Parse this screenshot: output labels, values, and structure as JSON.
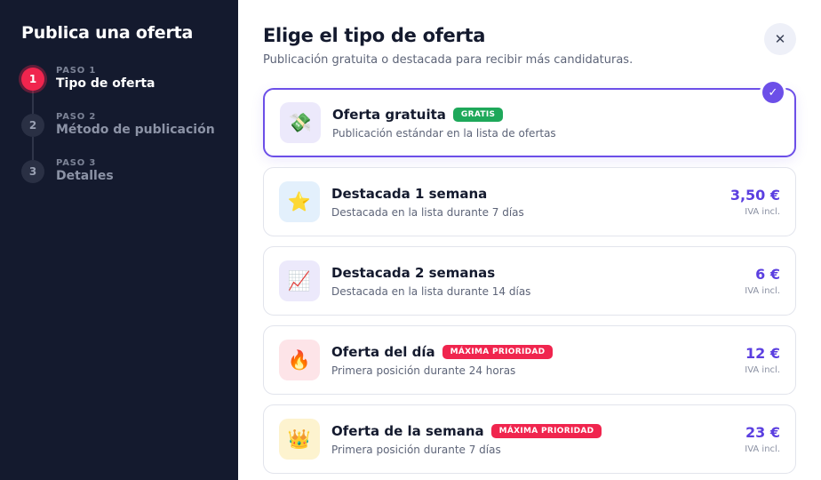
{
  "sidebar": {
    "title": "Publica una oferta",
    "steps": [
      {
        "number": "1",
        "kicker": "PASO 1",
        "label": "Tipo de oferta",
        "active": true
      },
      {
        "number": "2",
        "kicker": "PASO 2",
        "label": "Método de publicación",
        "active": false
      },
      {
        "number": "3",
        "kicker": "PASO 3",
        "label": "Detalles",
        "active": false
      }
    ]
  },
  "main": {
    "title": "Elige el tipo de oferta",
    "subtitle": "Publicación gratuita o destacada para recibir más candidaturas.",
    "close_icon": "✕",
    "check_icon": "✓"
  },
  "options": [
    {
      "title": "Oferta gratuita",
      "badge": "GRATIS",
      "badge_color": "#1ea85a",
      "description": "Publicación estándar en la lista de ofertas",
      "price": "",
      "price_note": "",
      "icon": "money-wings-icon",
      "icon_glyph": "💸",
      "icon_bg": "#ece9fb",
      "selected": true
    },
    {
      "title": "Destacada 1 semana",
      "badge": "",
      "badge_color": "",
      "description": "Destacada en la lista durante 7 días",
      "price": "3,50 €",
      "price_note": "IVA incl.",
      "icon": "star-icon",
      "icon_glyph": "⭐",
      "icon_bg": "#e3f0fc",
      "selected": false
    },
    {
      "title": "Destacada 2 semanas",
      "badge": "",
      "badge_color": "",
      "description": "Destacada en la lista durante 14 días",
      "price": "6 €",
      "price_note": "IVA incl.",
      "icon": "chart-up-icon",
      "icon_glyph": "📈",
      "icon_bg": "#ece9fb",
      "selected": false
    },
    {
      "title": "Oferta del día",
      "badge": "MÁXIMA PRIORIDAD",
      "badge_color": "#f0254e",
      "description": "Primera posición durante 24 horas",
      "price": "12 €",
      "price_note": "IVA incl.",
      "icon": "fire-icon",
      "icon_glyph": "🔥",
      "icon_bg": "#fde4e8",
      "selected": false
    },
    {
      "title": "Oferta de la semana",
      "badge": "MÁXIMA PRIORIDAD",
      "badge_color": "#f0254e",
      "description": "Primera posición durante 7 días",
      "price": "23 €",
      "price_note": "IVA incl.",
      "icon": "crown-icon",
      "icon_glyph": "👑",
      "icon_bg": "#fdf3cf",
      "selected": false
    }
  ]
}
